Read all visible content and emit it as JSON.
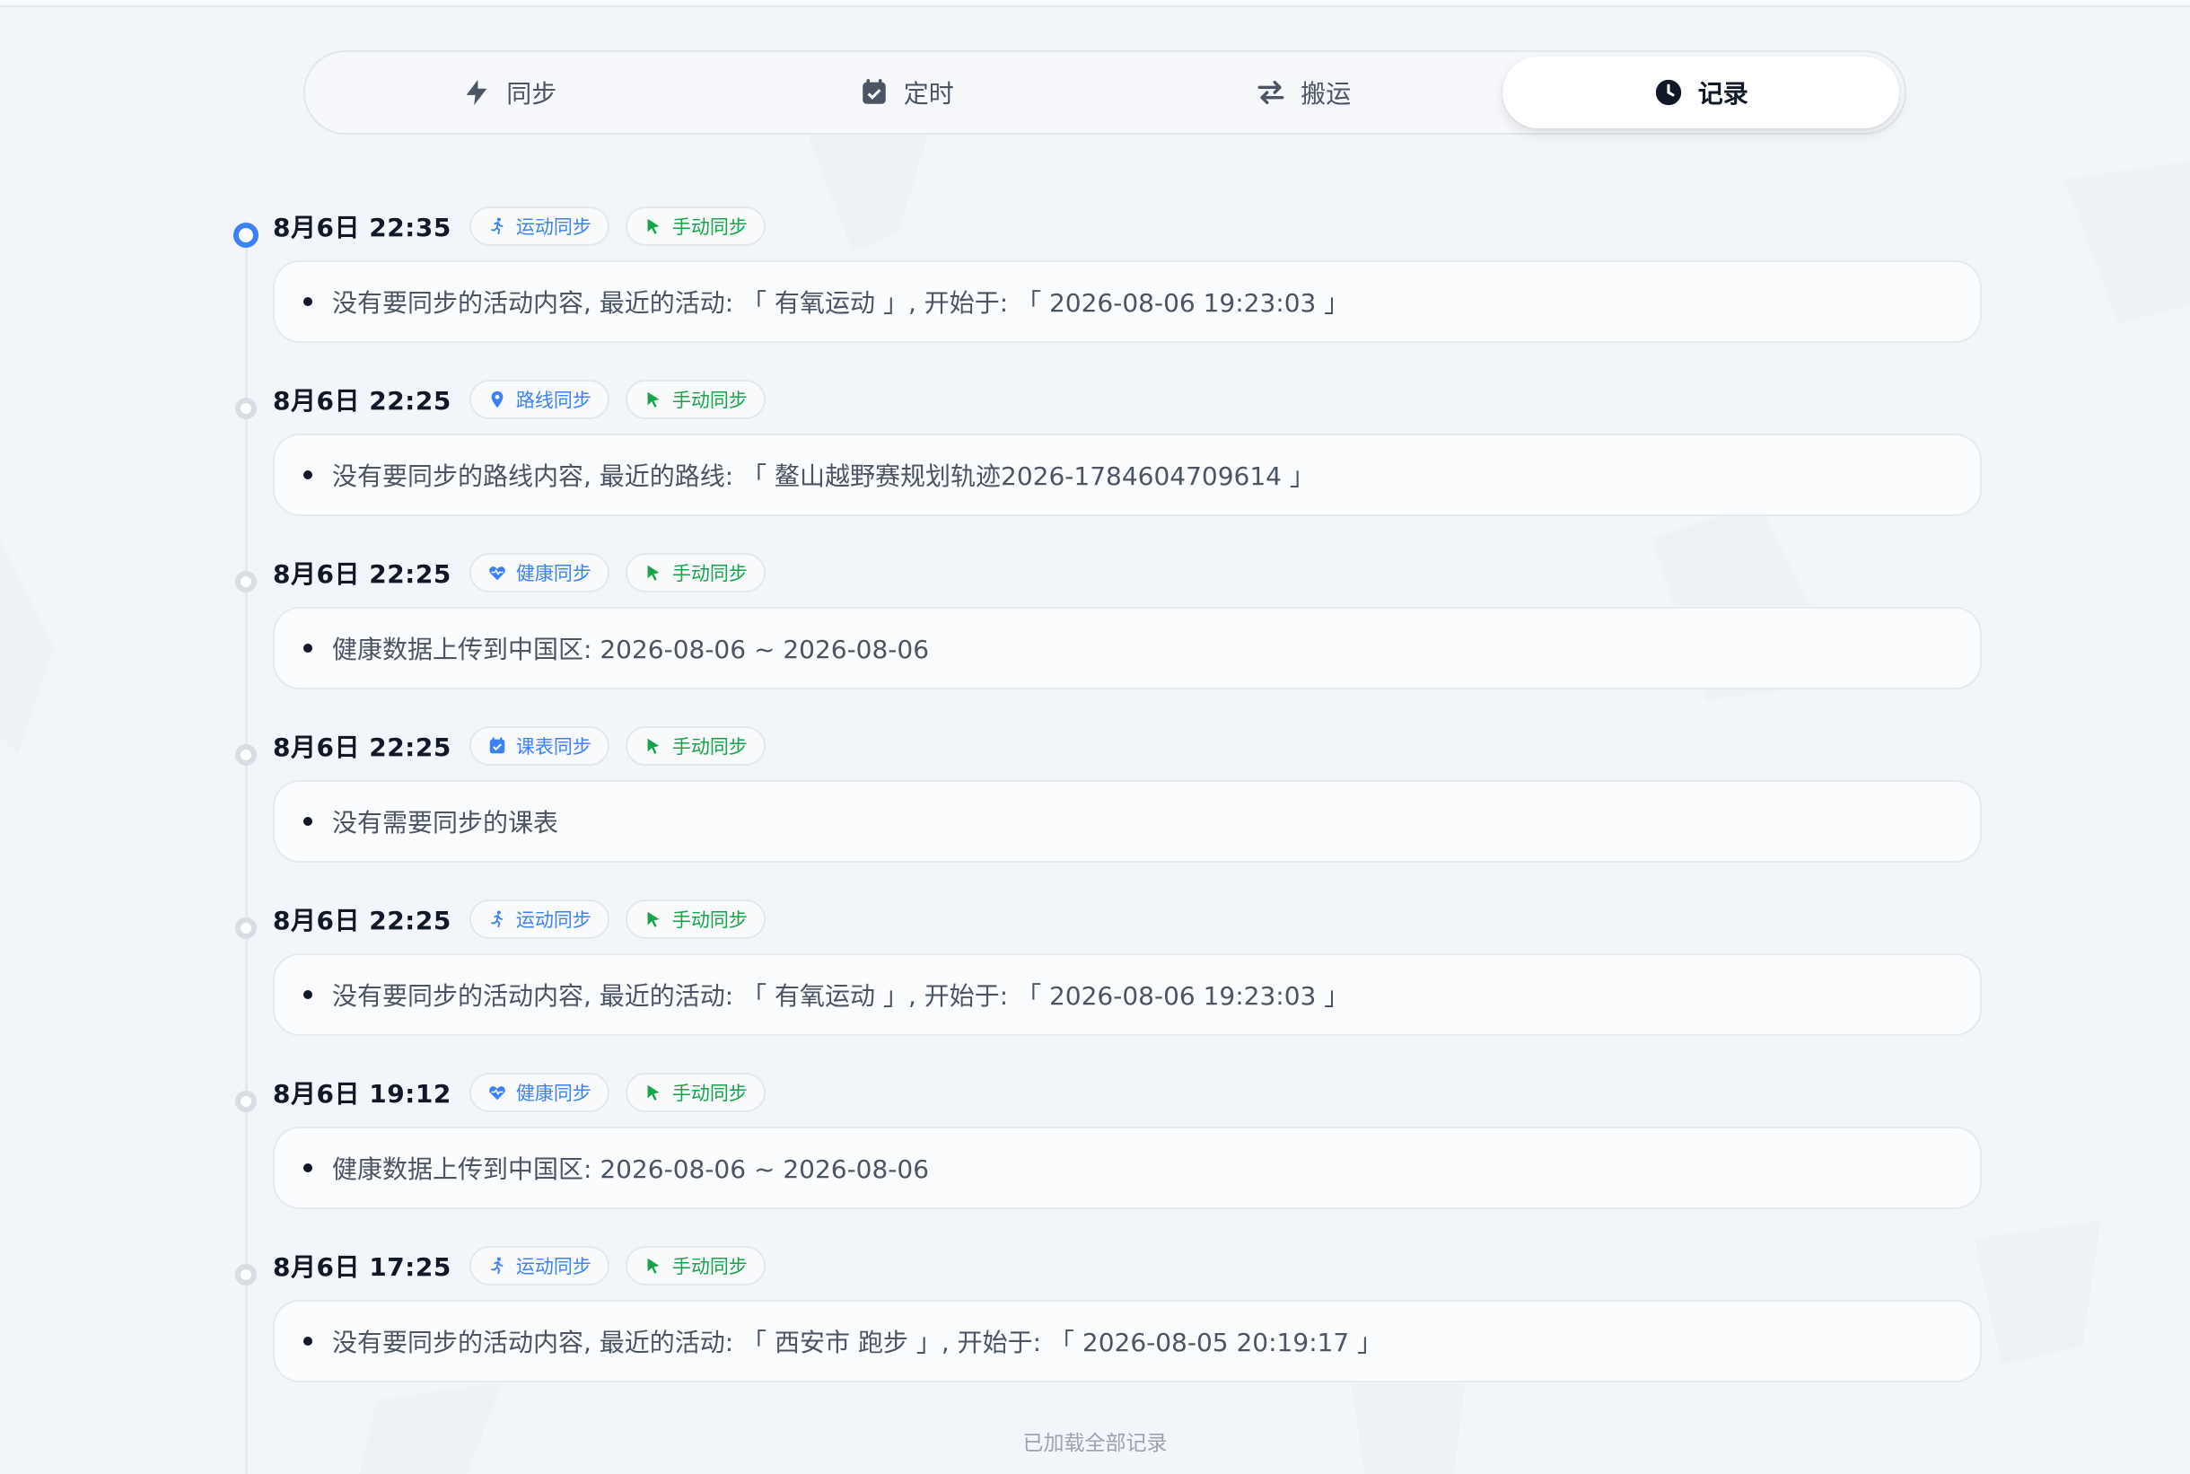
{
  "tabs": [
    {
      "label": "同步",
      "icon": "bolt-icon",
      "active": false
    },
    {
      "label": "定时",
      "icon": "calendar-check-icon",
      "active": false
    },
    {
      "label": "搬运",
      "icon": "transfer-arrows-icon",
      "active": false
    },
    {
      "label": "记录",
      "icon": "clock-icon",
      "active": true
    }
  ],
  "colors": {
    "accent_blue": "#3b82f6",
    "manual_green": "#16a34a",
    "background": "#f2f5f9"
  },
  "records": [
    {
      "time": "8月6日 22:35",
      "type_label": "运动同步",
      "type_icon": "running-person-icon",
      "mode_label": "手动同步",
      "mode_icon": "cursor-icon",
      "text": "没有要同步的活动内容, 最近的活动: 「 有氧运动 」, 开始于: 「 2026-08-06 19:23:03 」",
      "active": true
    },
    {
      "time": "8月6日 22:25",
      "type_label": "路线同步",
      "type_icon": "map-pin-icon",
      "mode_label": "手动同步",
      "mode_icon": "cursor-icon",
      "text": "没有要同步的路线内容, 最近的路线: 「 鳌山越野赛规划轨迹2026-1784604709614 」",
      "active": false
    },
    {
      "time": "8月6日 22:25",
      "type_label": "健康同步",
      "type_icon": "heart-pulse-icon",
      "mode_label": "手动同步",
      "mode_icon": "cursor-icon",
      "text": "健康数据上传到中国区: 2026-08-06 ~ 2026-08-06",
      "active": false
    },
    {
      "time": "8月6日 22:25",
      "type_label": "课表同步",
      "type_icon": "calendar-check-icon",
      "mode_label": "手动同步",
      "mode_icon": "cursor-icon",
      "text": "没有需要同步的课表",
      "active": false
    },
    {
      "time": "8月6日 22:25",
      "type_label": "运动同步",
      "type_icon": "running-person-icon",
      "mode_label": "手动同步",
      "mode_icon": "cursor-icon",
      "text": "没有要同步的活动内容, 最近的活动: 「 有氧运动 」, 开始于: 「 2026-08-06 19:23:03 」",
      "active": false
    },
    {
      "time": "8月6日 19:12",
      "type_label": "健康同步",
      "type_icon": "heart-pulse-icon",
      "mode_label": "手动同步",
      "mode_icon": "cursor-icon",
      "text": "健康数据上传到中国区: 2026-08-06 ~ 2026-08-06",
      "active": false
    },
    {
      "time": "8月6日 17:25",
      "type_label": "运动同步",
      "type_icon": "running-person-icon",
      "mode_label": "手动同步",
      "mode_icon": "cursor-icon",
      "text": "没有要同步的活动内容, 最近的活动: 「 西安市 跑步 」, 开始于: 「 2026-08-05 20:19:17 」",
      "active": false
    }
  ],
  "footer": {
    "text": "已加载全部记录"
  }
}
